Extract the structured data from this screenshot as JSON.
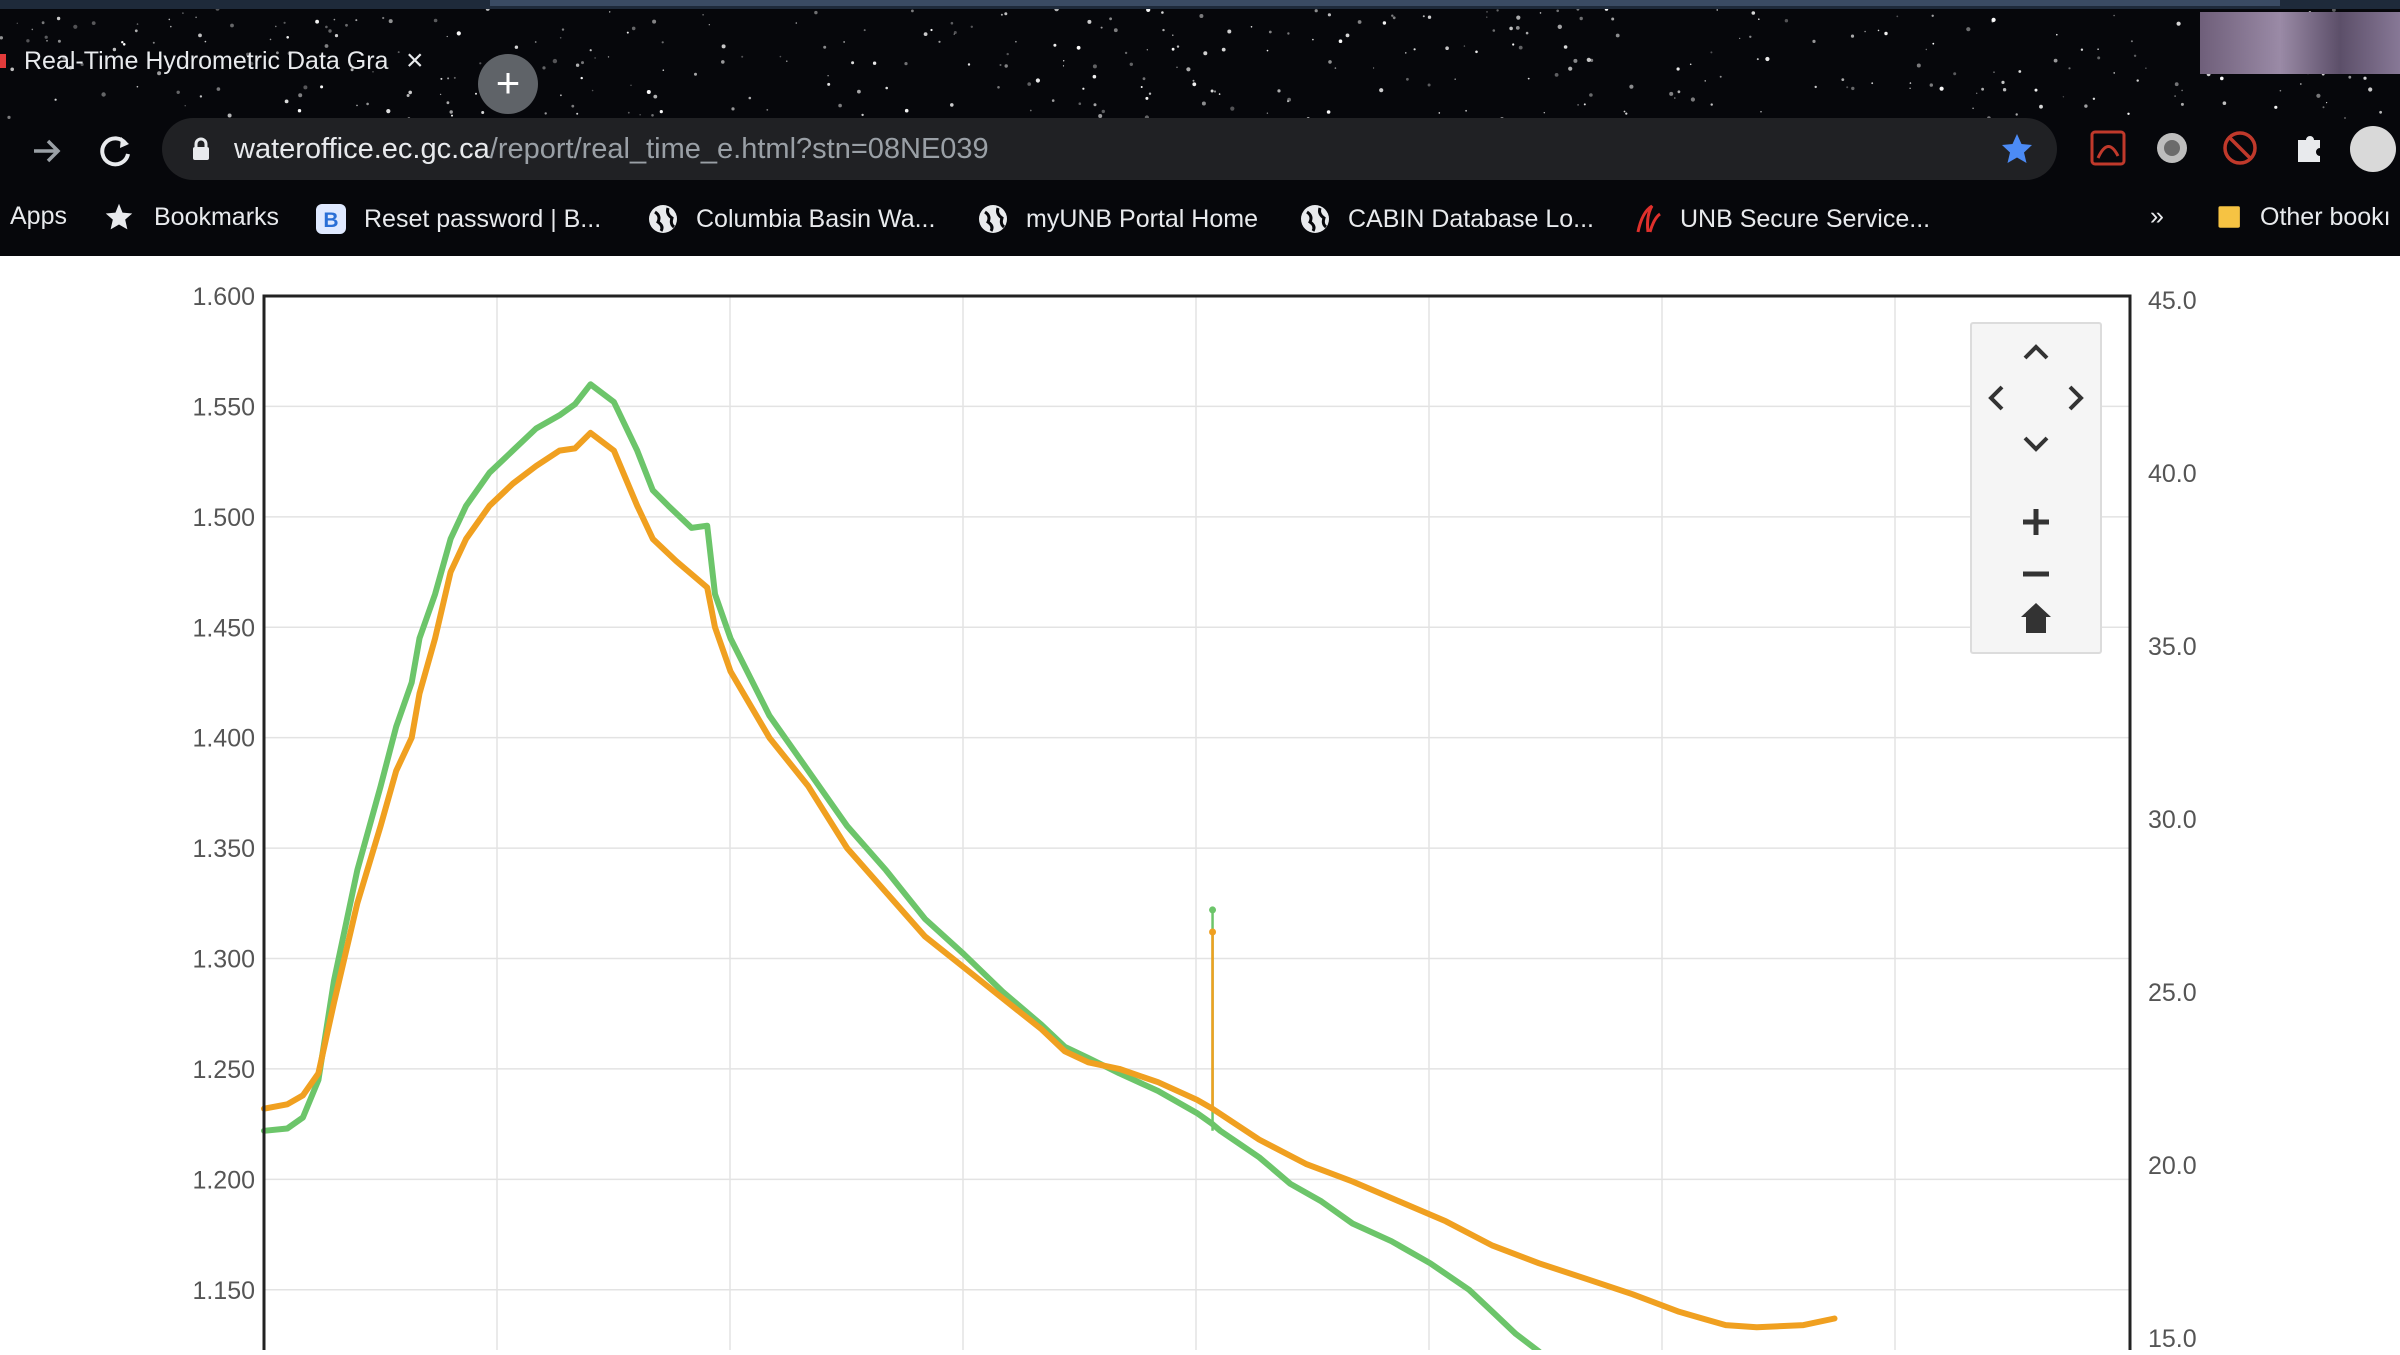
{
  "browser": {
    "tab": {
      "title": "Real-Time Hydrometric Data Gra",
      "close_icon": "×"
    },
    "new_tab_icon": "+",
    "url": {
      "host": "wateroffice.ec.gc.ca",
      "path": "/report/real_time_e.html?stn=08NE039"
    },
    "bookmarks": [
      {
        "label": "Apps",
        "icon": "apps-icon"
      },
      {
        "label": "Bookmarks",
        "icon": "star-icon"
      },
      {
        "label": "Reset password | B...",
        "icon": "b-logo-icon"
      },
      {
        "label": "Columbia Basin Wa...",
        "icon": "globe-icon"
      },
      {
        "label": "myUNB Portal Home",
        "icon": "globe-icon"
      },
      {
        "label": "CABIN Database Lo...",
        "icon": "globe-icon"
      },
      {
        "label": "UNB Secure Service...",
        "icon": "unb-logo-icon"
      }
    ],
    "more_bookmarks": "»",
    "other_bookmarks": "Other bookı"
  },
  "chart_data": {
    "type": "line",
    "left_axis": {
      "ticks": [
        "1.600",
        "1.550",
        "1.500",
        "1.450",
        "1.400",
        "1.350",
        "1.300",
        "1.250",
        "1.200",
        "1.150"
      ],
      "range": [
        1.12,
        1.6
      ]
    },
    "right_axis": {
      "ticks": [
        "45.0",
        "40.0",
        "35.0",
        "30.0",
        "25.0",
        "20.0",
        "15.0"
      ],
      "range": [
        15.0,
        45.0
      ]
    },
    "grid": true,
    "x_gridlines": 8,
    "colors": {
      "green": "#6cc56a",
      "orange": "#f0a020"
    },
    "series": [
      {
        "color": "green",
        "axis": "left",
        "points": [
          [
            0.0,
            1.222
          ],
          [
            0.03,
            1.223
          ],
          [
            0.05,
            1.228
          ],
          [
            0.07,
            1.245
          ],
          [
            0.09,
            1.29
          ],
          [
            0.12,
            1.34
          ],
          [
            0.15,
            1.378
          ],
          [
            0.17,
            1.405
          ],
          [
            0.19,
            1.425
          ],
          [
            0.2,
            1.445
          ],
          [
            0.22,
            1.465
          ],
          [
            0.24,
            1.49
          ],
          [
            0.26,
            1.505
          ],
          [
            0.29,
            1.52
          ],
          [
            0.32,
            1.53
          ],
          [
            0.35,
            1.54
          ],
          [
            0.38,
            1.546
          ],
          [
            0.4,
            1.551
          ],
          [
            0.42,
            1.56
          ],
          [
            0.45,
            1.552
          ],
          [
            0.48,
            1.53
          ],
          [
            0.5,
            1.512
          ],
          [
            0.52,
            1.505
          ],
          [
            0.55,
            1.495
          ],
          [
            0.57,
            1.496
          ],
          [
            0.58,
            1.465
          ],
          [
            0.6,
            1.445
          ],
          [
            0.65,
            1.41
          ],
          [
            0.7,
            1.385
          ],
          [
            0.75,
            1.36
          ],
          [
            0.8,
            1.34
          ],
          [
            0.85,
            1.318
          ],
          [
            0.9,
            1.302
          ],
          [
            0.95,
            1.285
          ],
          [
            1.0,
            1.27
          ],
          [
            1.03,
            1.26
          ],
          [
            1.06,
            1.255
          ],
          [
            1.1,
            1.248
          ],
          [
            1.15,
            1.24
          ],
          [
            1.2,
            1.23
          ],
          [
            1.22,
            1.225
          ],
          [
            1.23,
            1.222
          ],
          [
            1.28,
            1.21
          ],
          [
            1.32,
            1.198
          ],
          [
            1.36,
            1.19
          ],
          [
            1.4,
            1.18
          ],
          [
            1.45,
            1.172
          ],
          [
            1.5,
            1.162
          ],
          [
            1.55,
            1.15
          ],
          [
            1.58,
            1.14
          ],
          [
            1.61,
            1.13
          ],
          [
            1.64,
            1.122
          ]
        ],
        "spike": {
          "x": 1.22,
          "from": 1.222,
          "to": 1.322
        }
      },
      {
        "color": "orange",
        "axis": "left",
        "points": [
          [
            0.0,
            1.232
          ],
          [
            0.03,
            1.234
          ],
          [
            0.05,
            1.238
          ],
          [
            0.07,
            1.248
          ],
          [
            0.09,
            1.28
          ],
          [
            0.12,
            1.325
          ],
          [
            0.15,
            1.36
          ],
          [
            0.17,
            1.385
          ],
          [
            0.19,
            1.4
          ],
          [
            0.2,
            1.42
          ],
          [
            0.22,
            1.445
          ],
          [
            0.24,
            1.475
          ],
          [
            0.26,
            1.49
          ],
          [
            0.29,
            1.505
          ],
          [
            0.32,
            1.515
          ],
          [
            0.35,
            1.523
          ],
          [
            0.38,
            1.53
          ],
          [
            0.4,
            1.531
          ],
          [
            0.42,
            1.538
          ],
          [
            0.45,
            1.53
          ],
          [
            0.48,
            1.505
          ],
          [
            0.5,
            1.49
          ],
          [
            0.53,
            1.48
          ],
          [
            0.57,
            1.468
          ],
          [
            0.58,
            1.45
          ],
          [
            0.6,
            1.43
          ],
          [
            0.65,
            1.4
          ],
          [
            0.7,
            1.378
          ],
          [
            0.75,
            1.35
          ],
          [
            0.8,
            1.33
          ],
          [
            0.85,
            1.31
          ],
          [
            0.9,
            1.296
          ],
          [
            0.95,
            1.282
          ],
          [
            1.0,
            1.268
          ],
          [
            1.03,
            1.258
          ],
          [
            1.06,
            1.253
          ],
          [
            1.1,
            1.25
          ],
          [
            1.15,
            1.244
          ],
          [
            1.2,
            1.236
          ],
          [
            1.22,
            1.232
          ],
          [
            1.28,
            1.218
          ],
          [
            1.34,
            1.207
          ],
          [
            1.4,
            1.199
          ],
          [
            1.46,
            1.19
          ],
          [
            1.52,
            1.181
          ],
          [
            1.58,
            1.17
          ],
          [
            1.64,
            1.162
          ],
          [
            1.7,
            1.155
          ],
          [
            1.76,
            1.148
          ],
          [
            1.82,
            1.14
          ],
          [
            1.85,
            1.137
          ],
          [
            1.88,
            1.134
          ],
          [
            1.92,
            1.133
          ],
          [
            1.98,
            1.134
          ],
          [
            2.02,
            1.137
          ]
        ],
        "spike": {
          "x": 1.22,
          "from": 1.232,
          "to": 1.312
        }
      }
    ]
  },
  "nav_panel": {
    "up_icon": "chevron-up-icon",
    "left_icon": "chevron-left-icon",
    "right_icon": "chevron-right-icon",
    "down_icon": "chevron-down-icon",
    "zoom_in_icon": "plus-icon",
    "zoom_out_icon": "minus-icon",
    "home_icon": "home-icon"
  }
}
